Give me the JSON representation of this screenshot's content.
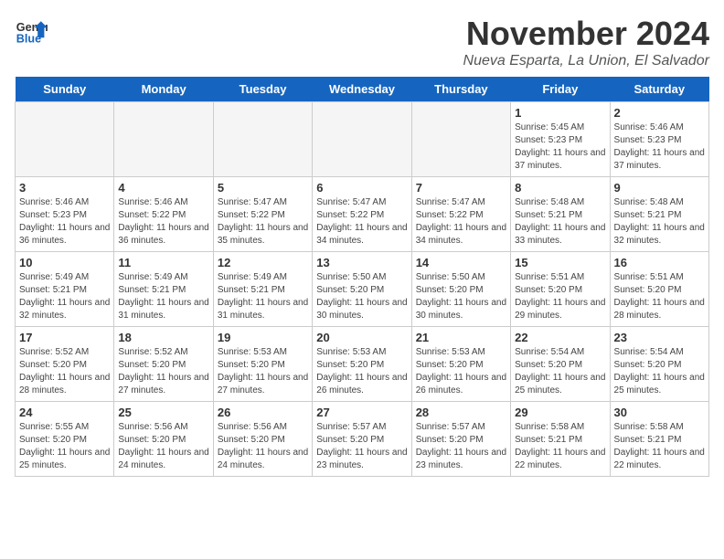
{
  "logo": {
    "general": "General",
    "blue": "Blue"
  },
  "title": "November 2024",
  "subtitle": "Nueva Esparta, La Union, El Salvador",
  "days_header": [
    "Sunday",
    "Monday",
    "Tuesday",
    "Wednesday",
    "Thursday",
    "Friday",
    "Saturday"
  ],
  "weeks": [
    [
      {
        "day": "",
        "info": ""
      },
      {
        "day": "",
        "info": ""
      },
      {
        "day": "",
        "info": ""
      },
      {
        "day": "",
        "info": ""
      },
      {
        "day": "",
        "info": ""
      },
      {
        "day": "1",
        "info": "Sunrise: 5:45 AM\nSunset: 5:23 PM\nDaylight: 11 hours\nand 37 minutes."
      },
      {
        "day": "2",
        "info": "Sunrise: 5:46 AM\nSunset: 5:23 PM\nDaylight: 11 hours\nand 37 minutes."
      }
    ],
    [
      {
        "day": "3",
        "info": "Sunrise: 5:46 AM\nSunset: 5:23 PM\nDaylight: 11 hours\nand 36 minutes."
      },
      {
        "day": "4",
        "info": "Sunrise: 5:46 AM\nSunset: 5:22 PM\nDaylight: 11 hours\nand 36 minutes."
      },
      {
        "day": "5",
        "info": "Sunrise: 5:47 AM\nSunset: 5:22 PM\nDaylight: 11 hours\nand 35 minutes."
      },
      {
        "day": "6",
        "info": "Sunrise: 5:47 AM\nSunset: 5:22 PM\nDaylight: 11 hours\nand 34 minutes."
      },
      {
        "day": "7",
        "info": "Sunrise: 5:47 AM\nSunset: 5:22 PM\nDaylight: 11 hours\nand 34 minutes."
      },
      {
        "day": "8",
        "info": "Sunrise: 5:48 AM\nSunset: 5:21 PM\nDaylight: 11 hours\nand 33 minutes."
      },
      {
        "day": "9",
        "info": "Sunrise: 5:48 AM\nSunset: 5:21 PM\nDaylight: 11 hours\nand 32 minutes."
      }
    ],
    [
      {
        "day": "10",
        "info": "Sunrise: 5:49 AM\nSunset: 5:21 PM\nDaylight: 11 hours\nand 32 minutes."
      },
      {
        "day": "11",
        "info": "Sunrise: 5:49 AM\nSunset: 5:21 PM\nDaylight: 11 hours\nand 31 minutes."
      },
      {
        "day": "12",
        "info": "Sunrise: 5:49 AM\nSunset: 5:21 PM\nDaylight: 11 hours\nand 31 minutes."
      },
      {
        "day": "13",
        "info": "Sunrise: 5:50 AM\nSunset: 5:20 PM\nDaylight: 11 hours\nand 30 minutes."
      },
      {
        "day": "14",
        "info": "Sunrise: 5:50 AM\nSunset: 5:20 PM\nDaylight: 11 hours\nand 30 minutes."
      },
      {
        "day": "15",
        "info": "Sunrise: 5:51 AM\nSunset: 5:20 PM\nDaylight: 11 hours\nand 29 minutes."
      },
      {
        "day": "16",
        "info": "Sunrise: 5:51 AM\nSunset: 5:20 PM\nDaylight: 11 hours\nand 28 minutes."
      }
    ],
    [
      {
        "day": "17",
        "info": "Sunrise: 5:52 AM\nSunset: 5:20 PM\nDaylight: 11 hours\nand 28 minutes."
      },
      {
        "day": "18",
        "info": "Sunrise: 5:52 AM\nSunset: 5:20 PM\nDaylight: 11 hours\nand 27 minutes."
      },
      {
        "day": "19",
        "info": "Sunrise: 5:53 AM\nSunset: 5:20 PM\nDaylight: 11 hours\nand 27 minutes."
      },
      {
        "day": "20",
        "info": "Sunrise: 5:53 AM\nSunset: 5:20 PM\nDaylight: 11 hours\nand 26 minutes."
      },
      {
        "day": "21",
        "info": "Sunrise: 5:53 AM\nSunset: 5:20 PM\nDaylight: 11 hours\nand 26 minutes."
      },
      {
        "day": "22",
        "info": "Sunrise: 5:54 AM\nSunset: 5:20 PM\nDaylight: 11 hours\nand 25 minutes."
      },
      {
        "day": "23",
        "info": "Sunrise: 5:54 AM\nSunset: 5:20 PM\nDaylight: 11 hours\nand 25 minutes."
      }
    ],
    [
      {
        "day": "24",
        "info": "Sunrise: 5:55 AM\nSunset: 5:20 PM\nDaylight: 11 hours\nand 25 minutes."
      },
      {
        "day": "25",
        "info": "Sunrise: 5:56 AM\nSunset: 5:20 PM\nDaylight: 11 hours\nand 24 minutes."
      },
      {
        "day": "26",
        "info": "Sunrise: 5:56 AM\nSunset: 5:20 PM\nDaylight: 11 hours\nand 24 minutes."
      },
      {
        "day": "27",
        "info": "Sunrise: 5:57 AM\nSunset: 5:20 PM\nDaylight: 11 hours\nand 23 minutes."
      },
      {
        "day": "28",
        "info": "Sunrise: 5:57 AM\nSunset: 5:20 PM\nDaylight: 11 hours\nand 23 minutes."
      },
      {
        "day": "29",
        "info": "Sunrise: 5:58 AM\nSunset: 5:21 PM\nDaylight: 11 hours\nand 22 minutes."
      },
      {
        "day": "30",
        "info": "Sunrise: 5:58 AM\nSunset: 5:21 PM\nDaylight: 11 hours\nand 22 minutes."
      }
    ]
  ]
}
